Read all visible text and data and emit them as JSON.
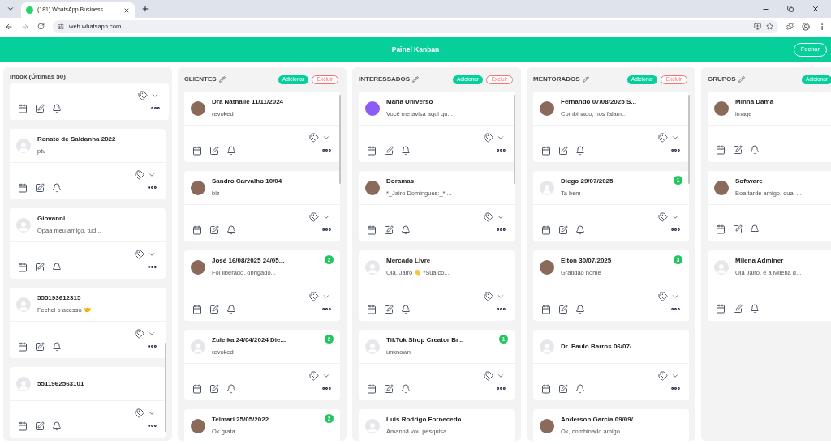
{
  "browser": {
    "tab_title": "(181) WhatsApp Business",
    "url": "web.whatsapp.com"
  },
  "header": {
    "title": "Painel Kanban",
    "close_button": "Fechar"
  },
  "columns": [
    {
      "kind": "inbox",
      "title": "Inbox (Últimas 50)",
      "actions_visible": true,
      "cards": [
        {
          "kind": "partial"
        },
        {
          "kind": "full",
          "avatar": {
            "kind": "default"
          },
          "name": "Renato de Saldanha 2022",
          "message": "ptv"
        },
        {
          "kind": "full",
          "avatar": {
            "kind": "default"
          },
          "name": "Giovanni",
          "message": "Opaa meu amigo, tud..."
        },
        {
          "kind": "full",
          "avatar": {
            "kind": "default"
          },
          "name": "555193612315",
          "message": "Fechei o acesso 🤝"
        },
        {
          "kind": "full",
          "avatar": {
            "kind": "default"
          },
          "name": "5511962563101"
        }
      ]
    },
    {
      "kind": "stage",
      "title": "CLIENTES",
      "actions_visible": true,
      "buttons": [
        {
          "kind": "add",
          "label": "Adicionar"
        },
        {
          "kind": "delete",
          "label": "Excluir"
        }
      ],
      "cards": [
        {
          "kind": "full",
          "avatar": {
            "kind": "photo"
          },
          "name": "Dra Nathalie 11/11/2024",
          "message": "revoked"
        },
        {
          "kind": "full",
          "avatar": {
            "kind": "photo"
          },
          "name": "Sandro Carvalho 10/04",
          "message": "blz"
        },
        {
          "kind": "full",
          "avatar": {
            "kind": "photo"
          },
          "name": "José 16/08/2025 24/05...",
          "message": "Foi liberado, obrigado...",
          "badge": "2"
        },
        {
          "kind": "full",
          "avatar": {
            "kind": "default"
          },
          "name": "Zuleika 24/04/2024 Die...",
          "message": "revoked",
          "badge": "2"
        },
        {
          "kind": "full",
          "avatar": {
            "kind": "photo"
          },
          "name": "Telmari 25/05/2022",
          "message": "Ok grata",
          "badge": "2"
        }
      ]
    },
    {
      "kind": "stage",
      "title": "INTERESSADOS",
      "actions_visible": true,
      "buttons": [
        {
          "kind": "add",
          "label": "Adicionar"
        },
        {
          "kind": "delete",
          "label": "Excluir"
        }
      ],
      "cards": [
        {
          "kind": "full",
          "avatar": {
            "kind": "logo"
          },
          "name": "Maria Universo",
          "message": "Você me avisa aqui qu..."
        },
        {
          "kind": "full",
          "avatar": {
            "kind": "photo"
          },
          "name": "Doramas",
          "message": "*_Jairo Domingues:_* ..."
        },
        {
          "kind": "full",
          "avatar": {
            "kind": "default"
          },
          "name": "Mercado Livre",
          "message": "Olá, Jairo 👋 *Sua co..."
        },
        {
          "kind": "full",
          "avatar": {
            "kind": "default"
          },
          "name": "TikTok Shop Creator Br...",
          "message": "unknown",
          "badge": "1"
        },
        {
          "kind": "full",
          "avatar": {
            "kind": "default"
          },
          "name": "Luis Rodrigo Fornecedo...",
          "message": "Amanhã vou pesquisa..."
        }
      ]
    },
    {
      "kind": "stage",
      "title": "MENTORADOS",
      "actions_visible": true,
      "buttons": [
        {
          "kind": "add",
          "label": "Adicionar"
        },
        {
          "kind": "delete",
          "label": "Excluir"
        }
      ],
      "cards": [
        {
          "kind": "full",
          "avatar": {
            "kind": "photo"
          },
          "name": "Fernando 07/08/2025 S...",
          "message": "Combinado, nos falam..."
        },
        {
          "kind": "full",
          "avatar": {
            "kind": "default"
          },
          "name": "Diego 29/07/2025",
          "message": "Ta bem",
          "badge": "1"
        },
        {
          "kind": "full",
          "avatar": {
            "kind": "photo"
          },
          "name": "Elton 30/07/2025",
          "message": "Gratidão home",
          "badge": "3"
        },
        {
          "kind": "full",
          "avatar": {
            "kind": "default"
          },
          "name": "Dr. Paulo Barros 06/07/..."
        },
        {
          "kind": "full",
          "avatar": {
            "kind": "photo"
          },
          "name": "Anderson Garcia 09/09/...",
          "message": "Ok, combinado amigo"
        }
      ]
    },
    {
      "kind": "stage",
      "title": "GRUPOS",
      "actions_visible": false,
      "buttons": [
        {
          "kind": "add",
          "label": "Adicionar"
        }
      ],
      "cards": [
        {
          "kind": "full",
          "avatar": {
            "kind": "photo"
          },
          "name": "Minha Dama",
          "message": "image"
        },
        {
          "kind": "full",
          "avatar": {
            "kind": "photo"
          },
          "name": "Software",
          "message": "Boa tarde amigo, qual ..."
        },
        {
          "kind": "full",
          "avatar": {
            "kind": "default"
          },
          "name": "Milena Adminer",
          "message": "Olá Jairo, é a Milena d..."
        }
      ]
    }
  ]
}
